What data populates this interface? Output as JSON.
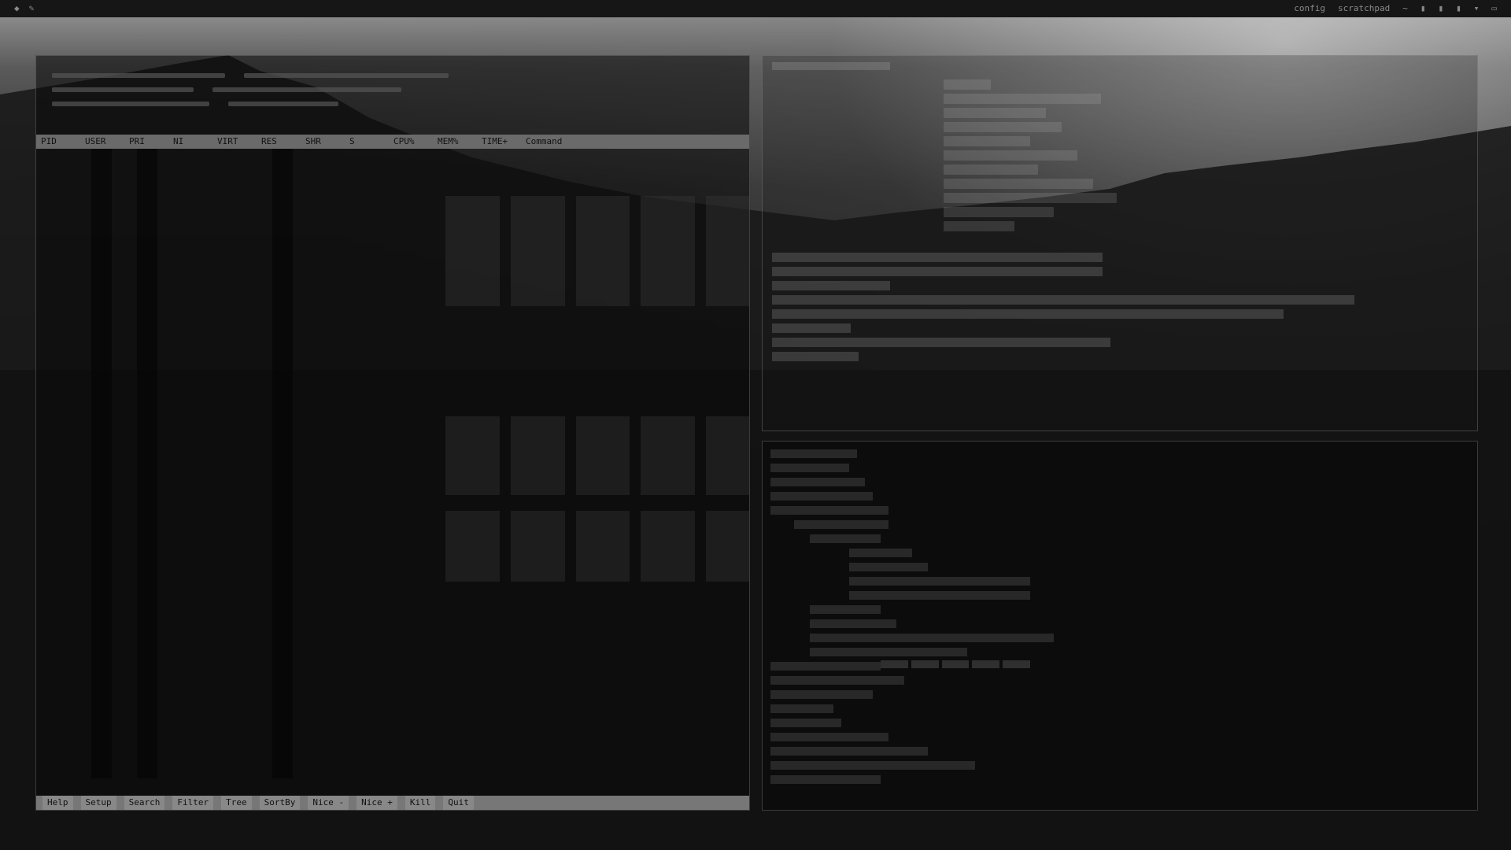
{
  "topbar": {
    "left_icons": [
      "app-icon",
      "edit-icon"
    ],
    "items": [
      "config",
      "scratchpad",
      "~",
      "",
      "",
      "",
      "",
      ""
    ]
  },
  "htop": {
    "header_columns": [
      "PID",
      "USER",
      "PRI",
      "NI",
      "VIRT",
      "RES",
      "SHR",
      "S",
      "CPU%",
      "MEM%",
      "TIME+",
      "Command"
    ],
    "footer_keys": [
      "Help",
      "Setup",
      "Search",
      "Filter",
      "Tree",
      "SortBy",
      "Nice -",
      "Nice +",
      "Kill",
      "Quit"
    ]
  },
  "neofetch": {
    "line_count": 11
  },
  "log": {
    "status_left": "",
    "status_right": ""
  },
  "colors": {
    "background": "#111111",
    "panel_border": "#969696",
    "text": "#9a9a9a",
    "bar_header": "#6a6a6a"
  }
}
